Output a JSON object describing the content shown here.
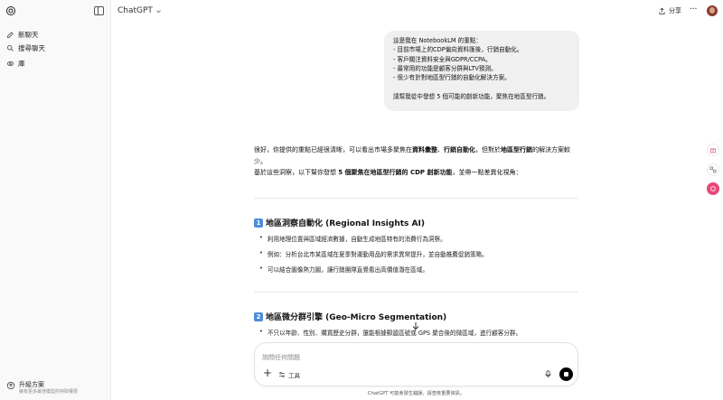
{
  "sidebar": {
    "items": [
      {
        "label": "新聊天",
        "icon": "edit-icon"
      },
      {
        "label": "搜尋聊天",
        "icon": "search-icon"
      },
      {
        "label": "庫",
        "icon": "library-icon"
      }
    ],
    "upgrade": {
      "title": "升級方案",
      "subtitle": "擁有更多最佳模型的存取權限"
    }
  },
  "header": {
    "model": "ChatGPT",
    "share_label": "分享"
  },
  "user_message": {
    "lines": [
      "這是我在 NotebookLM 的重點：",
      "- 目前市場上的CDP偏向資料匯後，行銷自動化。",
      "- 客戶關注資料安全與GDPR/CCPA。",
      "- 最常用的功能是顧客分群與LTV預測。",
      "- 很少有針對地區型行銷的自動化解決方案。",
      "",
      "請幫我從中發想 5 個可能的創新功能，聚焦在地區型行銷。"
    ]
  },
  "assistant": {
    "intro_1": "很好，你提供的重點已經很清晰，可以看出市場多聚焦在",
    "intro_1_b1": "資料彙整",
    "intro_1_mid": "、",
    "intro_1_b2": "行銷自動化",
    "intro_1_tail": "，但對於",
    "intro_1_b3": "地區型行銷",
    "intro_1_end": "的解決方案較少。",
    "intro_2a": "基於這些洞察，以下幫你發想 ",
    "intro_2b": "5 個聚焦在地區型行銷的 CDP 創新功能",
    "intro_2c": "，並帶一點差異化視角：",
    "sections": [
      {
        "num": "1",
        "title": "地區洞察自動化 (Regional Insights AI)",
        "bullets": [
          "利用地理位置與區域經濟數據，自動生成地區特有的消費行為洞察。",
          "例如：分析台北市某區域在夏季對運動用品的需求異常提升，並自動推薦促銷策略。",
          "可以結合圖像熱力圖，讓行銷團隊直覺看出高價值潛在區域。"
        ]
      },
      {
        "num": "2",
        "title": "地區微分群引擎 (Geo-Micro Segmentation)",
        "bullets": [
          "不只以年齡、性別、購買歷史分群，還能根據郵遞區號或 GPS 聚合後的微區域，進行顧客分群。"
        ]
      }
    ]
  },
  "composer": {
    "placeholder": "詢問任何問題",
    "tools_label": "工具"
  },
  "footer_note": "ChatGPT 可能會發生錯誤。請查核重要資訊。",
  "colors": {
    "accent": "#4d8cd8",
    "sidebar_bg": "#f9f9f9",
    "bubble_bg": "#f0f0f0"
  }
}
